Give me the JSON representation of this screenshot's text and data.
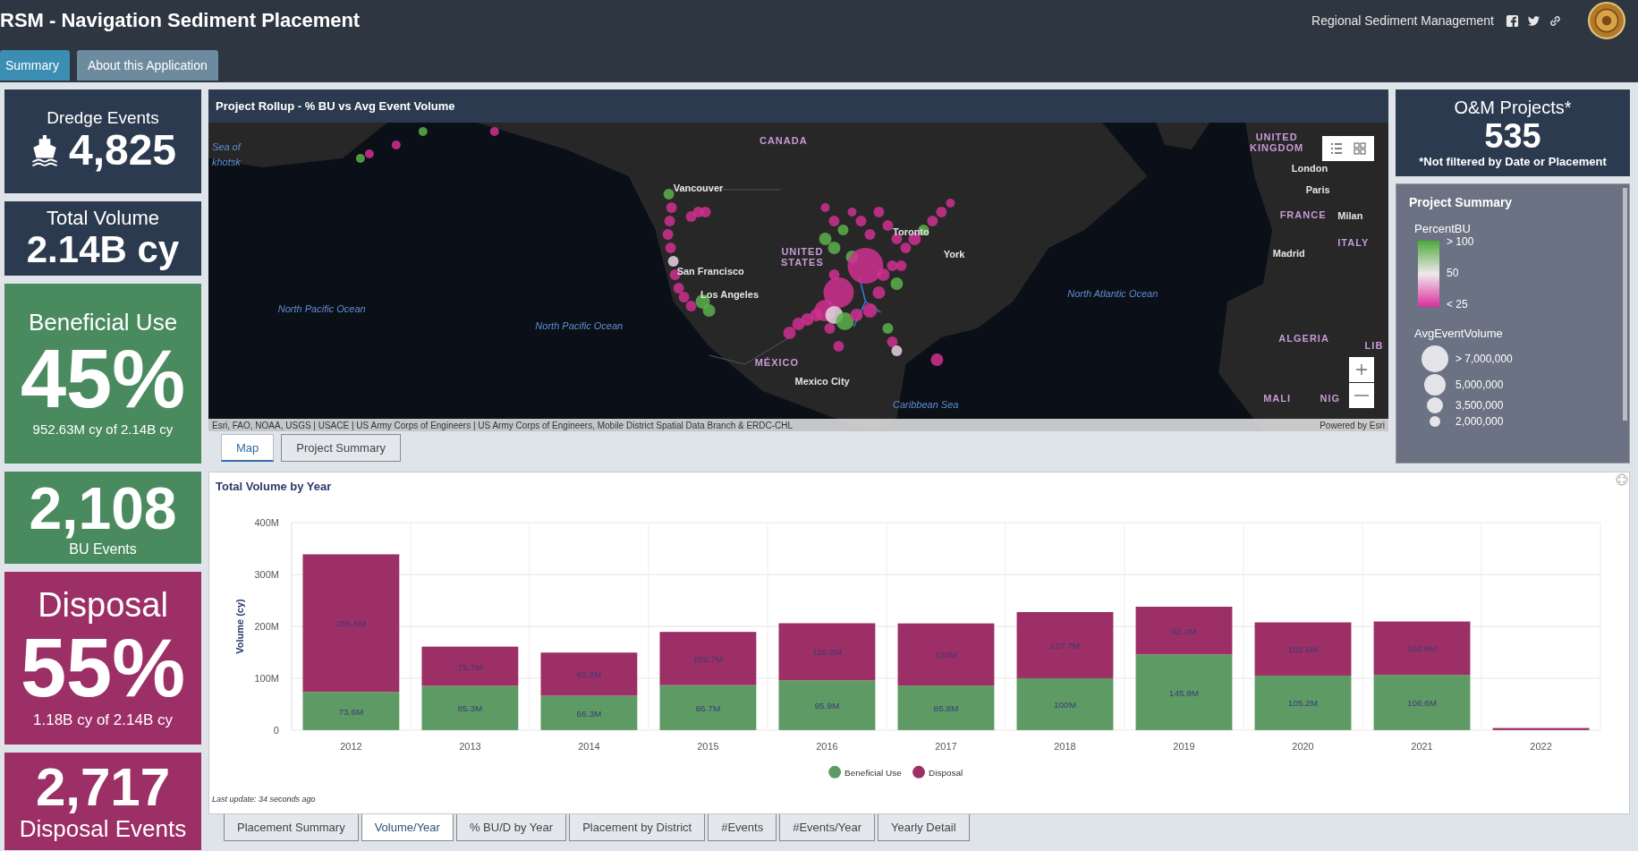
{
  "header": {
    "title": "RSM - Navigation Sediment Placement",
    "link": "Regional Sediment Management"
  },
  "tabs": [
    {
      "label": "Summary",
      "selected": true
    },
    {
      "label": "About this Application",
      "selected": false
    }
  ],
  "cards": [
    {
      "title": "Dredge Events",
      "value": "4,825",
      "color": "#2b3a4e"
    },
    {
      "title": "Total Volume",
      "value": "2.14B cy",
      "color": "#2b3a4e"
    },
    {
      "title": "Beneficial Use",
      "value": "45%",
      "caption": "952.63M cy of 2.14B cy",
      "color": "#4a8a5f"
    },
    {
      "value": "2,108",
      "caption": "BU Events",
      "color": "#4a8a5f"
    },
    {
      "title": "Disposal",
      "value": "55%",
      "caption": "1.18B cy of 2.14B cy",
      "color": "#9c2f65"
    },
    {
      "value": "2,717",
      "caption": "Disposal Events",
      "color": "#9c2f65"
    }
  ],
  "map_panel": {
    "title": "Project Rollup - % BU vs Avg Event Volume",
    "labels": [
      {
        "text": "Sea of",
        "kind": "ocean"
      },
      {
        "text": "khotsk",
        "kind": "ocean"
      },
      {
        "text": "CANADA",
        "kind": "country"
      },
      {
        "text": "UNITED KINGDOM",
        "kind": "country"
      },
      {
        "text": "London",
        "kind": "city"
      },
      {
        "text": "Paris",
        "kind": "city"
      },
      {
        "text": "FRANCE",
        "kind": "country"
      },
      {
        "text": "Milan",
        "kind": "city"
      },
      {
        "text": "ITALY",
        "kind": "country"
      },
      {
        "text": "Madrid",
        "kind": "city"
      },
      {
        "text": "Vancouver",
        "kind": "city"
      },
      {
        "text": "Toronto",
        "kind": "city"
      },
      {
        "text": "UNITED STATES",
        "kind": "country"
      },
      {
        "text": "York",
        "kind": "city"
      },
      {
        "text": "San Francisco",
        "kind": "city"
      },
      {
        "text": "Los Angeles",
        "kind": "city"
      },
      {
        "text": "North Pacific Ocean",
        "kind": "ocean"
      },
      {
        "text": "North Pacific Ocean",
        "kind": "ocean"
      },
      {
        "text": "North Atlantic Ocean",
        "kind": "ocean"
      },
      {
        "text": "ALGERIA",
        "kind": "country"
      },
      {
        "text": "LIB",
        "kind": "country"
      },
      {
        "text": "MÉXICO",
        "kind": "country"
      },
      {
        "text": "Mexico City",
        "kind": "city"
      },
      {
        "text": "MALI",
        "kind": "country"
      },
      {
        "text": "NIG",
        "kind": "country"
      },
      {
        "text": "Caribbean Sea",
        "kind": "ocean"
      }
    ],
    "attribution": "Esri, FAO, NOAA, USGS | USACE | US Army Corps of Engineers | US Army Corps of Engineers, Mobile District Spatial Data Branch & ERDC-CHL",
    "powered_by": "Powered by Esri",
    "tabs": [
      {
        "label": "Map",
        "selected": true
      },
      {
        "label": "Project Summary",
        "selected": false
      }
    ]
  },
  "projects_card": {
    "title": "O&M Projects*",
    "value": "535",
    "note": "*Not filtered by Date or Placement"
  },
  "legend": {
    "title": "Project Summary",
    "color_field": "PercentBU",
    "color_stops": [
      "> 100",
      "50",
      "< 25"
    ],
    "size_field": "AvgEventVolume",
    "size_stops": [
      "> 7,000,000",
      "5,000,000",
      "3,500,000",
      "2,000,000"
    ]
  },
  "chart_panel": {
    "title": "Total Volume by Year",
    "last_update": "Last update: 34 seconds ago",
    "chart_data": {
      "type": "bar",
      "stacked": true,
      "ylabel": "Volume (cy)",
      "categories": [
        "2012",
        "2013",
        "2014",
        "2015",
        "2016",
        "2017",
        "2018",
        "2019",
        "2020",
        "2021",
        "2022"
      ],
      "series": [
        {
          "name": "Beneficial Use",
          "color": "#5e9a64",
          "values": [
            73.6,
            85.3,
            66.3,
            86.7,
            95.9,
            85.8,
            100,
            145.9,
            105.2,
            106.6,
            0
          ],
          "value_labels": [
            "73.6M",
            "85.3M",
            "66.3M",
            "86.7M",
            "95.9M",
            "85.8M",
            "100M",
            "145.9M",
            "105.2M",
            "106.6M",
            null
          ]
        },
        {
          "name": "Disposal",
          "color": "#9c2f65",
          "values": [
            265.5,
            75.7,
            83.2,
            102.7,
            110.2,
            120,
            127.7,
            92.1,
            102.6,
            102.9,
            4
          ],
          "value_labels": [
            "265.5M",
            "75.7M",
            "83.2M",
            "102.7M",
            "110.2M",
            "120M",
            "127.7M",
            "92.1M",
            "102.6M",
            "102.9M",
            null
          ]
        }
      ],
      "ylim": [
        0,
        400
      ],
      "yticks": [
        {
          "value": 0,
          "label": "0"
        },
        {
          "value": 100,
          "label": "100M"
        },
        {
          "value": 200,
          "label": "200M"
        },
        {
          "value": 300,
          "label": "300M"
        },
        {
          "value": 400,
          "label": "400M"
        }
      ],
      "grid": true,
      "legend": "bottom"
    },
    "tabs": [
      {
        "label": "Placement Summary",
        "selected": false
      },
      {
        "label": "Volume/Year",
        "selected": true
      },
      {
        "label": "% BU/D by Year",
        "selected": false
      },
      {
        "label": "Placement by District",
        "selected": false
      },
      {
        "label": "#Events",
        "selected": false
      },
      {
        "label": "#Events/Year",
        "selected": false
      },
      {
        "label": "Yearly Detail",
        "selected": false
      }
    ]
  }
}
